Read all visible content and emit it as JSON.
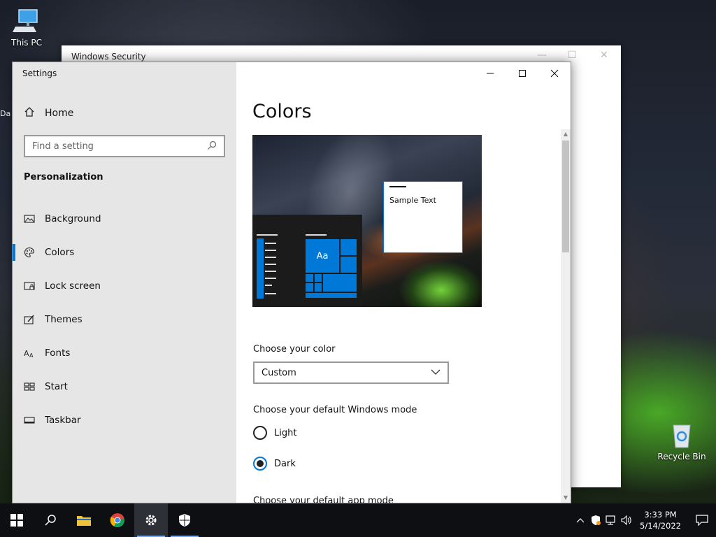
{
  "desktop": {
    "icons": [
      {
        "label": "This PC"
      },
      {
        "label": "Recycle Bin"
      }
    ],
    "partial_icon_label": "Da"
  },
  "security_window": {
    "title": "Windows Security"
  },
  "settings_window": {
    "title": "Settings",
    "sidebar": {
      "home_label": "Home",
      "search_placeholder": "Find a setting",
      "section_header": "Personalization",
      "items": [
        {
          "label": "Background",
          "icon": "picture-icon"
        },
        {
          "label": "Colors",
          "icon": "palette-icon",
          "active": true
        },
        {
          "label": "Lock screen",
          "icon": "lock-screen-icon"
        },
        {
          "label": "Themes",
          "icon": "brush-icon"
        },
        {
          "label": "Fonts",
          "icon": "font-icon"
        },
        {
          "label": "Start",
          "icon": "start-grid-icon"
        },
        {
          "label": "Taskbar",
          "icon": "taskbar-icon"
        }
      ]
    },
    "main": {
      "page_title": "Colors",
      "preview": {
        "tile_text": "Aa",
        "sample_text": "Sample Text"
      },
      "choose_color_label": "Choose your color",
      "color_value": "Custom",
      "windows_mode_label": "Choose your default Windows mode",
      "windows_mode_options": [
        "Light",
        "Dark"
      ],
      "windows_mode_selected": "Dark",
      "app_mode_label": "Choose your default app mode"
    }
  },
  "taskbar": {
    "pinned": [
      "start-icon",
      "search-icon",
      "file-explorer-icon",
      "chrome-icon",
      "settings-icon",
      "windows-security-icon"
    ],
    "time": "3:33 PM",
    "date": "5/14/2022"
  },
  "colors": {
    "accent": "#0078d7",
    "taskbar_bg": "#0d0f12",
    "sidebar_bg": "#e6e6e6"
  }
}
